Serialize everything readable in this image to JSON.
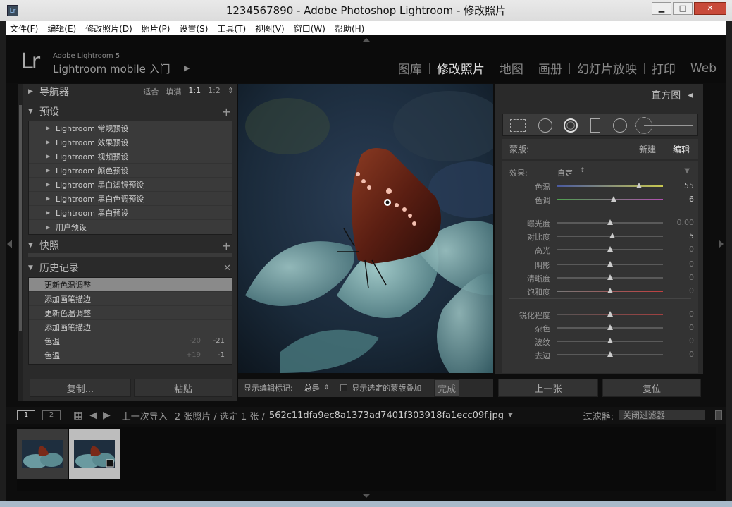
{
  "window": {
    "title": "1234567890 - Adobe Photoshop Lightroom - 修改照片",
    "icon_label": "Lr",
    "minimize": "▁",
    "maximize": "□",
    "close": "✕"
  },
  "menu": [
    "文件(F)",
    "编辑(E)",
    "修改照片(D)",
    "照片(P)",
    "设置(S)",
    "工具(T)",
    "视图(V)",
    "窗口(W)",
    "帮助(H)"
  ],
  "identity": {
    "logo": "Lr",
    "sub": "Adobe Lightroom 5",
    "main": "Lightroom mobile 入门"
  },
  "modules": [
    {
      "label": "图库",
      "active": false
    },
    {
      "label": "修改照片",
      "active": true
    },
    {
      "label": "地图",
      "active": false
    },
    {
      "label": "画册",
      "active": false
    },
    {
      "label": "幻灯片放映",
      "active": false
    },
    {
      "label": "打印",
      "active": false
    },
    {
      "label": "Web",
      "active": false
    }
  ],
  "navigator": {
    "title": "导航器",
    "options": [
      "适合",
      "填满",
      "1:1",
      "1:2"
    ],
    "selected": "1:1"
  },
  "presets": {
    "title": "预设",
    "items": [
      "Lightroom 常规预设",
      "Lightroom 效果预设",
      "Lightroom 视频预设",
      "Lightroom 颜色预设",
      "Lightroom 黑白滤镜预设",
      "Lightroom 黑白色调预设",
      "Lightroom 黑白预设",
      "用户预设"
    ]
  },
  "snapshots": {
    "title": "快照"
  },
  "history": {
    "title": "历史记录",
    "items": [
      {
        "label": "更新色温调整",
        "a": "",
        "b": ""
      },
      {
        "label": "添加画笔描边",
        "a": "",
        "b": ""
      },
      {
        "label": "更新色温调整",
        "a": "",
        "b": ""
      },
      {
        "label": "添加画笔描边",
        "a": "",
        "b": ""
      },
      {
        "label": "色温",
        "a": "-20",
        "b": "-21"
      },
      {
        "label": "色温",
        "a": "+19",
        "b": "-1"
      }
    ]
  },
  "left_buttons": {
    "copy": "复制...",
    "paste": "粘贴"
  },
  "toolbar": {
    "show_pins": "显示编辑标记:",
    "pins_value": "总是",
    "show_mask": "显示选定的蒙版叠加",
    "done": "完成"
  },
  "right": {
    "histogram": "直方图",
    "mask_label": "蒙版:",
    "mask_new": "新建",
    "mask_edit": "编辑",
    "effect_label": "效果:",
    "effect_value": "自定",
    "sliders": [
      {
        "label": "色温",
        "value": "55",
        "pos": 0.77,
        "track": "temp"
      },
      {
        "label": "色调",
        "value": "6",
        "pos": 0.53,
        "track": "tint"
      },
      {
        "label": "曝光度",
        "value": "0.00",
        "pos": 0.5,
        "track": "plain"
      },
      {
        "label": "对比度",
        "value": "5",
        "pos": 0.52,
        "track": "plain"
      },
      {
        "label": "高光",
        "value": "0",
        "pos": 0.5,
        "track": "plain"
      },
      {
        "label": "阴影",
        "value": "0",
        "pos": 0.5,
        "track": "plain"
      },
      {
        "label": "清晰度",
        "value": "0",
        "pos": 0.5,
        "track": "plain"
      },
      {
        "label": "饱和度",
        "value": "0",
        "pos": 0.5,
        "track": "sat"
      },
      {
        "label": "锐化程度",
        "value": "0",
        "pos": 0.5,
        "track": "sharp"
      },
      {
        "label": "杂色",
        "value": "0",
        "pos": 0.5,
        "track": "plain"
      },
      {
        "label": "波纹",
        "value": "0",
        "pos": 0.5,
        "track": "plain"
      },
      {
        "label": "去边",
        "value": "0",
        "pos": 0.5,
        "track": "plain"
      }
    ],
    "prev": "上一张",
    "reset": "复位"
  },
  "filmstrip": {
    "view1": "1",
    "view2": "2",
    "source": "上一次导入",
    "count": "2 张照片 / 选定 1 张 /",
    "filename": "562c11dfa9ec8a1373ad7401f303918fa1ecc09f.jpg",
    "filter_label": "过滤器:",
    "filter_value": "关闭过滤器"
  },
  "colors": {
    "accent": "#dddddd",
    "panel": "#2a2a2a",
    "selected_history": "#8a8a8a"
  }
}
